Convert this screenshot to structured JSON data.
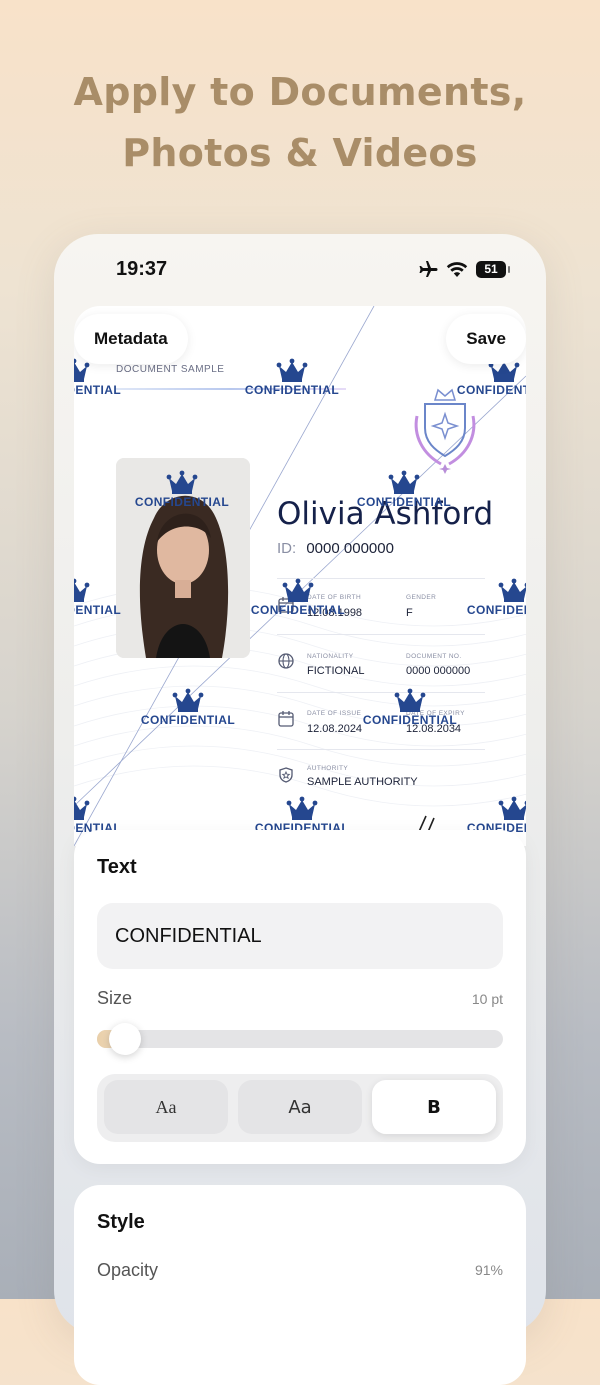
{
  "headline": {
    "line1": "Apply to Documents,",
    "line2": "Photos & Videos"
  },
  "status_bar": {
    "time": "19:37",
    "battery": "51"
  },
  "toolbar": {
    "metadata_label": "Metadata",
    "save_label": "Save"
  },
  "document": {
    "sample_label": "DOCUMENT SAMPLE",
    "name": "Olivia Ashford",
    "id_label": "ID:",
    "id_value": "0000 000000",
    "fields": [
      {
        "label": "DATE OF BIRTH",
        "value": "12.08.1998",
        "icon": "calendar-icon"
      },
      {
        "label": "GENDER",
        "value": "F"
      },
      {
        "label": "NATIONALITY",
        "value": "FICTIONAL",
        "icon": "globe-icon"
      },
      {
        "label": "DOCUMENT NO.",
        "value": "0000 000000"
      },
      {
        "label": "DATE OF ISSUE",
        "value": "12.08.2024",
        "icon": "calendar-icon"
      },
      {
        "label": "DATE OF EXPIRY",
        "value": "12.08.2034"
      },
      {
        "label": "AUTHORITY",
        "value": "SAMPLE AUTHORITY",
        "icon": "shield-icon"
      }
    ]
  },
  "watermark": {
    "text": "CONFIDENTIAL",
    "icon": "crown-icon",
    "color": "#25478f"
  },
  "text_panel": {
    "title": "Text",
    "input_value": "CONFIDENTIAL",
    "size_label": "Size",
    "size_value": "10 pt",
    "size_fraction": 0.08,
    "font_options": [
      "Aa",
      "Aa",
      "B"
    ],
    "selected_font_index": 2
  },
  "style_panel": {
    "title": "Style",
    "opacity_label": "Opacity",
    "opacity_value": "91%"
  },
  "colors": {
    "accent": "#a98d68",
    "navy": "#15214a",
    "watermark": "#25478f"
  }
}
